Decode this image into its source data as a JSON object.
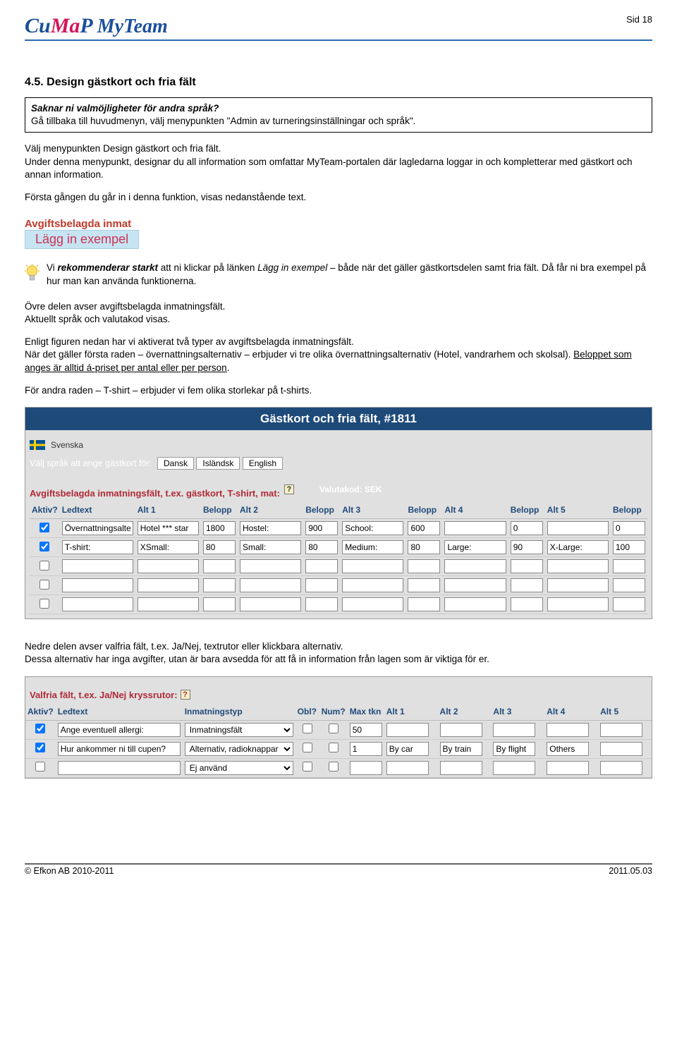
{
  "header": {
    "pagenum": "Sid 18",
    "logo_cumap_cu": "Cu",
    "logo_cumap_ma": "Ma",
    "logo_cumap_p": "P",
    "logo_myteam": "MyTeam"
  },
  "title": "4.5. Design gästkort och fria fält",
  "box": {
    "line1": "Saknar ni valmöjligheter för andra språk?",
    "line2": "Gå tillbaka till huvudmenyn, välj menypunkten \"Admin av turneringsinställningar och språk\"."
  },
  "p1": {
    "a": "Välj menypunkten Design gästkort och fria fält.",
    "b": "Under denna menypunkt, designar du all information som omfattar MyTeam-portalen där lagledarna loggar in och kompletterar med gästkort och annan information."
  },
  "p2": "Första gången du går in i denna funktion, visas nedanstående text.",
  "lex": {
    "top": "Avgiftsbelagda inmat",
    "btn": "Lägg in exempel"
  },
  "rec": {
    "a": "Vi ",
    "b": "rekommenderar starkt",
    "c": " att ni klickar på länken ",
    "d": "Lägg in exempel",
    "e": " – både när det gäller gästkortsdelen samt fria fält. Då får ni bra exempel på hur man kan använda funktionerna."
  },
  "p3": {
    "a": "Övre delen avser avgiftsbelagda inmatningsfält.",
    "b": "Aktuellt språk och valutakod visas."
  },
  "p4": {
    "a": "Enligt figuren nedan har vi aktiverat två typer av avgiftsbelagda inmatningsfält.",
    "b": "När det gäller första raden – övernattningsalternativ – erbjuder vi tre olika övernattningsalternativ (Hotel, vandrarhem och skolsal). ",
    "c": "Beloppet som anges är alltid á-priset per antal eller per person",
    "d": "."
  },
  "p5": "För andra raden – T-shirt – erbjuder vi fem olika storlekar på t-shirts.",
  "panel": {
    "title": "Gästkort och fria fält, #1811",
    "lang_name": "Svenska",
    "lang_label": "Välj språk att ange gästkort för:",
    "lang_buttons": [
      "Dansk",
      "Isländsk",
      "English"
    ],
    "sub_label": "Avgiftsbelagda inmatningsfält, t.ex. gästkort, T-shirt, mat:",
    "valutakod": "Valutakod: SEK",
    "cols": [
      "Aktiv?",
      "Ledtext",
      "Alt 1",
      "Belopp",
      "Alt 2",
      "Belopp",
      "Alt 3",
      "Belopp",
      "Alt 4",
      "Belopp",
      "Alt 5",
      "Belopp"
    ],
    "rows": [
      {
        "aktiv": true,
        "led": "Övernattningsalternativ:",
        "a1": "Hotel *** star",
        "b1": "1800",
        "a2": "Hostel:",
        "b2": "900",
        "a3": "School:",
        "b3": "600",
        "a4": "",
        "b4": "0",
        "a5": "",
        "b5": "0"
      },
      {
        "aktiv": true,
        "led": "T-shirt:",
        "a1": "XSmall:",
        "b1": "80",
        "a2": "Small:",
        "b2": "80",
        "a3": "Medium:",
        "b3": "80",
        "a4": "Large:",
        "b4": "90",
        "a5": "X-Large:",
        "b5": "100"
      },
      {
        "aktiv": false,
        "led": "",
        "a1": "",
        "b1": "",
        "a2": "",
        "b2": "",
        "a3": "",
        "b3": "",
        "a4": "",
        "b4": "",
        "a5": "",
        "b5": ""
      },
      {
        "aktiv": false,
        "led": "",
        "a1": "",
        "b1": "",
        "a2": "",
        "b2": "",
        "a3": "",
        "b3": "",
        "a4": "",
        "b4": "",
        "a5": "",
        "b5": ""
      },
      {
        "aktiv": false,
        "led": "",
        "a1": "",
        "b1": "",
        "a2": "",
        "b2": "",
        "a3": "",
        "b3": "",
        "a4": "",
        "b4": "",
        "a5": "",
        "b5": ""
      }
    ]
  },
  "p6": {
    "a": "Nedre delen avser valfria fält, t.ex. Ja/Nej, textrutor eller klickbara alternativ.",
    "b": "Dessa alternativ har inga avgifter, utan är bara avsedda för att få in information från lagen som är viktiga för er."
  },
  "panel2": {
    "sub": "Valfria fält, t.ex. Ja/Nej kryssrutor:",
    "cols": [
      "Aktiv?",
      "Ledtext",
      "Inmatningstyp",
      "Obl?",
      "Num?",
      "Max tkn",
      "Alt 1",
      "Alt 2",
      "Alt 3",
      "Alt 4",
      "Alt 5"
    ],
    "rows": [
      {
        "aktiv": true,
        "led": "Ange eventuell allergi:",
        "typ": "Inmatningsfält",
        "obl": false,
        "num": false,
        "max": "50",
        "a1": "",
        "a2": "",
        "a3": "",
        "a4": "",
        "a5": ""
      },
      {
        "aktiv": true,
        "led": "Hur ankommer ni till cupen?",
        "typ": "Alternativ, radioknappar",
        "obl": false,
        "num": false,
        "max": "1",
        "a1": "By car",
        "a2": "By train",
        "a3": "By flight",
        "a4": "Others",
        "a5": ""
      },
      {
        "aktiv": false,
        "led": "",
        "typ": "Ej använd",
        "obl": false,
        "num": false,
        "max": "",
        "a1": "",
        "a2": "",
        "a3": "",
        "a4": "",
        "a5": ""
      }
    ]
  },
  "footer": {
    "left": "© Efkon AB 2010-2011",
    "right": "2011.05.03"
  }
}
